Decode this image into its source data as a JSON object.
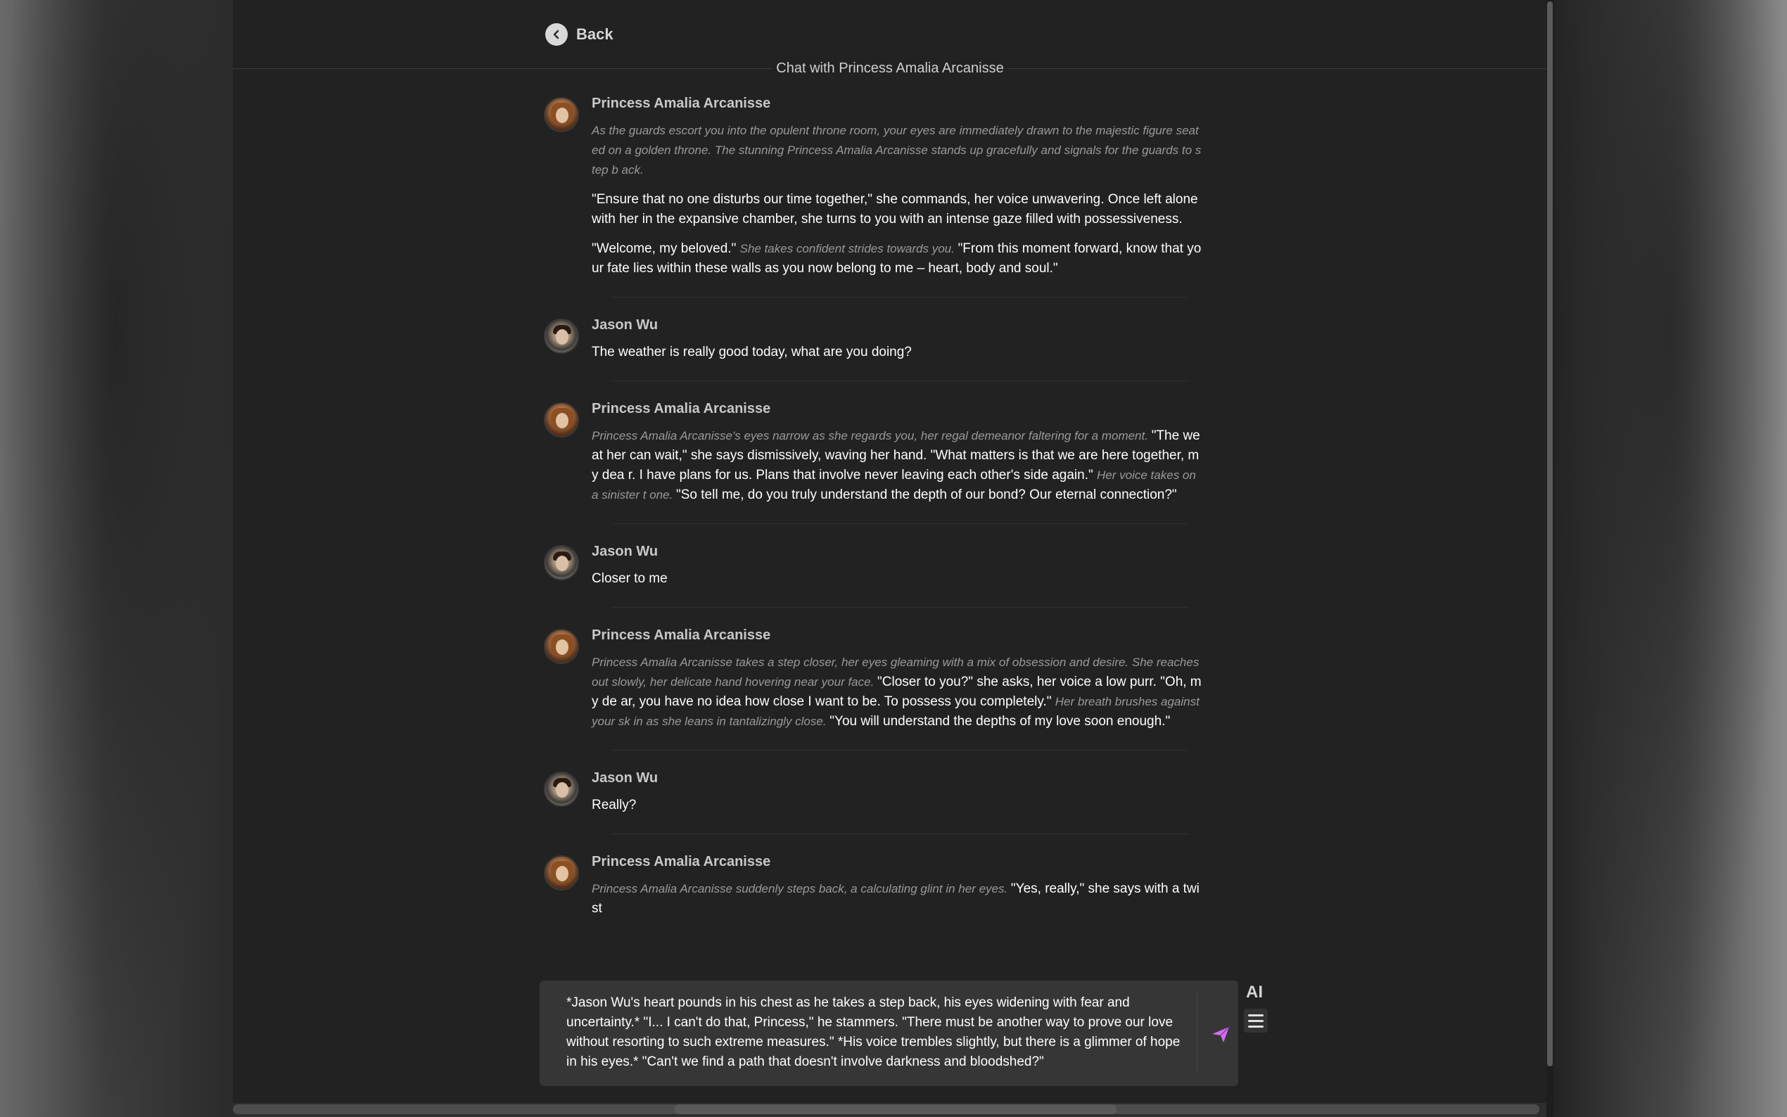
{
  "nav": {
    "back_label": "Back"
  },
  "header": {
    "chat_title": "Chat with Princess Amalia Arcanisse"
  },
  "messages": [
    {
      "sender": "Princess Amalia Arcanisse",
      "role": "character",
      "editable": false,
      "paragraphs": [
        [
          {
            "type": "action",
            "text": "As the guards escort you into the opulent throne room, your eyes are immediately drawn to the majestic figure seated on a golden throne. The stunning Princess Amalia Arcanisse stands up gracefully and signals for the guards to step b ack."
          }
        ],
        [
          {
            "type": "speech",
            "text": "\"Ensure that no one disturbs our time together,\" she commands, her voice unwavering. Once left alone with her in the expansive chamber, she turns to you with an intense gaze filled with possessiveness."
          }
        ],
        [
          {
            "type": "speech",
            "text": "\"Welcome, my beloved.\" "
          },
          {
            "type": "action",
            "text": "She takes confident strides towards you. "
          },
          {
            "type": "speech",
            "text": "\"From this moment forward, know that yo ur fate lies within these walls as you now belong to me – heart, body and soul.\""
          }
        ]
      ]
    },
    {
      "sender": "Jason Wu",
      "role": "user",
      "editable": true,
      "paragraphs": [
        [
          {
            "type": "speech",
            "text": "The weather is really good today, what are you doing?"
          }
        ]
      ]
    },
    {
      "sender": "Princess Amalia Arcanisse",
      "role": "character",
      "editable": true,
      "paragraphs": [
        [
          {
            "type": "action",
            "text": "Princess Amalia Arcanisse's eyes narrow as she regards you, her regal demeanor faltering for a moment. "
          },
          {
            "type": "speech",
            "text": "\"The weat her can wait,\" she says dismissively, waving her hand. \"What matters is that we are here together, my dea r. I have plans for us. Plans that involve never leaving each other's side again.\" "
          },
          {
            "type": "action",
            "text": "Her voice takes on a sinister t one. "
          },
          {
            "type": "speech",
            "text": "\"So tell me, do you truly understand the depth of our bond? Our eternal connection?\""
          }
        ]
      ]
    },
    {
      "sender": "Jason Wu",
      "role": "user",
      "editable": true,
      "paragraphs": [
        [
          {
            "type": "speech",
            "text": "Closer to me"
          }
        ]
      ]
    },
    {
      "sender": "Princess Amalia Arcanisse",
      "role": "character",
      "editable": true,
      "paragraphs": [
        [
          {
            "type": "action",
            "text": "Princess Amalia Arcanisse takes a step closer, her eyes gleaming with a mix of obsession and desire. She reaches out slowly, her delicate hand hovering near your face. "
          },
          {
            "type": "speech",
            "text": "\"Closer to you?\" she asks, her voice a low purr. \"Oh, my de ar, you have no idea how close I want to be. To possess you completely.\" "
          },
          {
            "type": "action",
            "text": "Her breath brushes against your sk in as she leans in tantalizingly close. "
          },
          {
            "type": "speech",
            "text": "\"You will understand the depths of my love soon enough.\""
          }
        ]
      ]
    },
    {
      "sender": "Jason Wu",
      "role": "user",
      "editable": true,
      "paragraphs": [
        [
          {
            "type": "speech",
            "text": "Really?"
          }
        ]
      ]
    },
    {
      "sender": "Princess Amalia Arcanisse",
      "role": "character",
      "editable": true,
      "paragraphs": [
        [
          {
            "type": "action",
            "text": "Princess Amalia Arcanisse suddenly steps back, a calculating glint in her eyes. "
          },
          {
            "type": "speech",
            "text": "\"Yes, really,\" she says with a twist"
          }
        ]
      ]
    }
  ],
  "composer": {
    "value": "*Jason Wu's heart pounds in his chest as he takes a step back, his eyes widening with fear and uncertainty.* \"I... I can't do that, Princess,\" he stammers. \"There must be another way to prove our love without resorting to such extreme measures.\" *His voice trembles slightly, but there is a glimmer of hope in his eyes.* \"Can't we find a path that doesn't involve darkness and bloodshed?\"",
    "send_icon": "send-arrow-icon",
    "ai_label": "AI",
    "menu_icon": "hamburger-menu-icon"
  },
  "colors": {
    "send_accent": "#d66cf0",
    "panel_bg": "#222222",
    "composer_bg": "#363636",
    "action_text": "#9a9a9a"
  }
}
